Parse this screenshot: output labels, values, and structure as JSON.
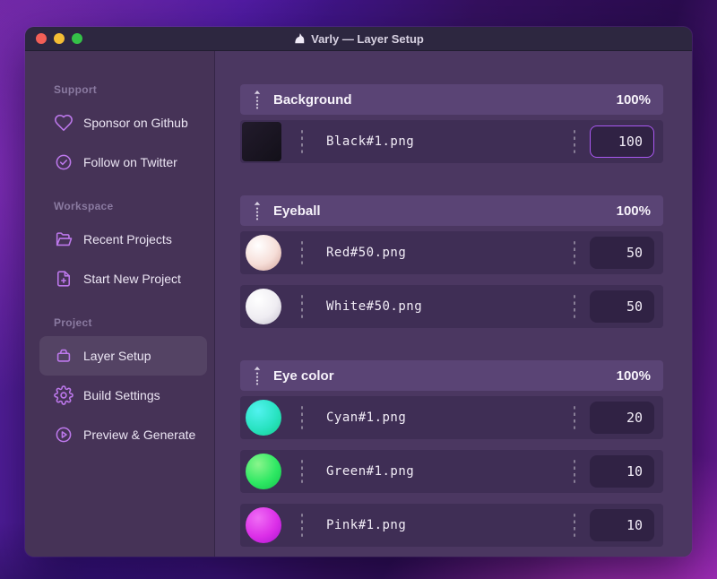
{
  "window": {
    "title": "Varly — Layer Setup",
    "app_icon": "unicorn-icon"
  },
  "sidebar": {
    "sections": [
      {
        "label": "Support",
        "items": [
          {
            "label": "Sponsor on Github",
            "icon": "heart-icon"
          },
          {
            "label": "Follow on Twitter",
            "icon": "badge-check-icon"
          }
        ]
      },
      {
        "label": "Workspace",
        "items": [
          {
            "label": "Recent Projects",
            "icon": "folder-open-icon"
          },
          {
            "label": "Start New Project",
            "icon": "file-plus-icon"
          }
        ]
      },
      {
        "label": "Project",
        "items": [
          {
            "label": "Layer Setup",
            "icon": "archive-box-icon",
            "selected": true
          },
          {
            "label": "Build Settings",
            "icon": "gear-icon"
          },
          {
            "label": "Preview & Generate",
            "icon": "play-circle-icon"
          }
        ]
      }
    ]
  },
  "layers": {
    "groups": [
      {
        "name": "Background",
        "weight": "100%",
        "items": [
          {
            "file": "Black#1.png",
            "value": "100",
            "thumb": "black",
            "focused": true
          }
        ]
      },
      {
        "name": "Eyeball",
        "weight": "100%",
        "items": [
          {
            "file": "Red#50.png",
            "value": "50",
            "thumb": "red"
          },
          {
            "file": "White#50.png",
            "value": "50",
            "thumb": "white"
          }
        ]
      },
      {
        "name": "Eye color",
        "weight": "100%",
        "items": [
          {
            "file": "Cyan#1.png",
            "value": "20",
            "thumb": "cyan"
          },
          {
            "file": "Green#1.png",
            "value": "10",
            "thumb": "green"
          },
          {
            "file": "Pink#1.png",
            "value": "10",
            "thumb": "pink"
          }
        ]
      }
    ]
  },
  "thumbnails": {
    "black": {
      "shape": "square",
      "colors": [
        "#221b2c",
        "#131019"
      ]
    },
    "red": {
      "shape": "sphere",
      "colors": [
        "#ffffff",
        "#f6ded8",
        "#cfa097"
      ]
    },
    "white": {
      "shape": "sphere",
      "colors": [
        "#ffffff",
        "#efedf2",
        "#c4bfcd"
      ]
    },
    "cyan": {
      "shape": "sphere",
      "colors": [
        "#52f2ef",
        "#29e3c2",
        "#13cf8a"
      ]
    },
    "green": {
      "shape": "sphere",
      "colors": [
        "#8af58c",
        "#2ee863",
        "#12c24b"
      ]
    },
    "pink": {
      "shape": "sphere",
      "colors": [
        "#f06df5",
        "#dc2fe8",
        "#a914cf"
      ]
    }
  },
  "colors": {
    "accent_focus_border": "#a958f1",
    "sidebar_icon": "#bd78ec",
    "window_bg": "#4b3761",
    "sidebar_bg": "#463357",
    "group_header_bg": "#5a4475",
    "row_bg": "#3f2e55",
    "titlebar_bg": "#2d2740"
  }
}
